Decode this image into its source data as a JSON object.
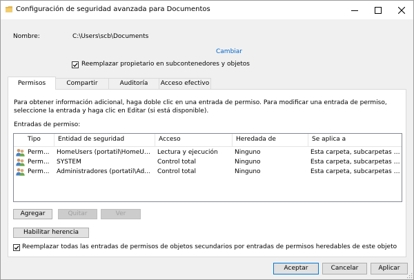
{
  "window": {
    "title": "Configuración de seguridad avanzada para Documentos",
    "buttons": [
      "minimize",
      "maximize",
      "close"
    ]
  },
  "header": {
    "name_label": "Nombre:",
    "name_value": "C:\\Users\\scb\\Documents",
    "change_link": "Cambiar",
    "replace_owner": {
      "label": "Reemplazar propietario en subcontenedores y objetos",
      "checked": true
    }
  },
  "tabs": [
    {
      "label": "Permisos",
      "active": true
    },
    {
      "label": "Compartir",
      "active": false
    },
    {
      "label": "Auditoría",
      "active": false
    },
    {
      "label": "Acceso efectivo",
      "active": false
    }
  ],
  "permissions": {
    "info_text": "Para obtener información adicional, haga doble clic en una entrada de permiso. Para modificar una entrada de permiso, seleccione la entrada y haga clic en Editar (si está disponible).",
    "entries_label": "Entradas de permiso:",
    "columns": [
      "Tipo",
      "Entidad de seguridad",
      "Acceso",
      "Heredada de",
      "Se aplica a"
    ],
    "rows": [
      {
        "icon": "users-icon",
        "tipo": "Perm...",
        "entidad": "HomeUsers (portatil\\HomeUs...",
        "acceso": "Lectura y ejecución",
        "heredada": "Ninguno",
        "aplica": "Esta carpeta, subcarpetas y arc..."
      },
      {
        "icon": "users-icon",
        "tipo": "Perm...",
        "entidad": "SYSTEM",
        "acceso": "Control total",
        "heredada": "Ninguno",
        "aplica": "Esta carpeta, subcarpetas y arc..."
      },
      {
        "icon": "users-icon",
        "tipo": "Perm...",
        "entidad": "Administradores (portatil\\Ad...",
        "acceso": "Control total",
        "heredada": "Ninguno",
        "aplica": "Esta carpeta, subcarpetas y arc..."
      }
    ],
    "buttons": {
      "add": "Agregar",
      "remove": "Quitar",
      "view": "Ver",
      "enable_inheritance": "Habilitar herencia"
    },
    "replace_all": {
      "label": "Reemplazar todas las entradas de permisos de objetos secundarios por entradas de permisos heredables de este objeto",
      "checked": true
    }
  },
  "footer": {
    "ok": "Aceptar",
    "cancel": "Cancelar",
    "apply": "Aplicar"
  },
  "colors": {
    "link": "#0066cc",
    "default_button_border": "#0078d7",
    "folder": "#e8b64c"
  }
}
